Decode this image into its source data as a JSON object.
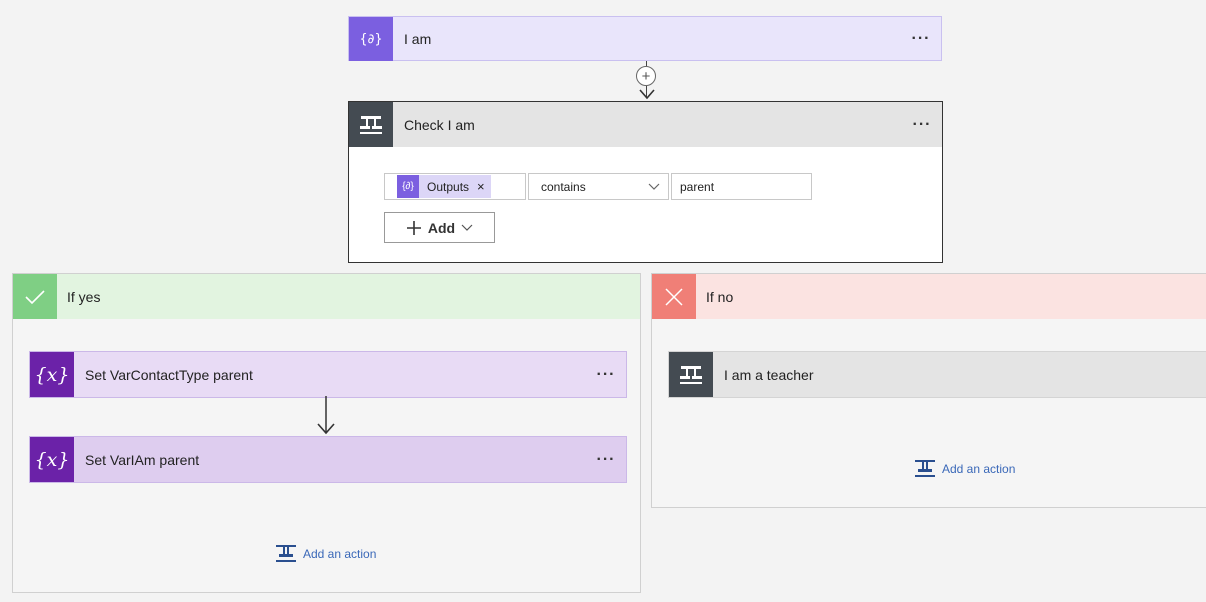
{
  "colors": {
    "variable_accent": "#7b5fe0",
    "set_variable_accent": "#6b22a8",
    "condition_accent": "#444b52",
    "yes_accent": "#7fcf84",
    "no_accent": "#f07f77",
    "link": "#3a68b8"
  },
  "steps": {
    "iam": {
      "title": "I am",
      "icon": "compose-icon",
      "more": "···"
    },
    "check": {
      "title": "Check I am",
      "icon": "condition-icon",
      "more": "···",
      "condition": {
        "left_token": "Outputs",
        "remove": "×",
        "operator": "contains",
        "right_value": "parent"
      },
      "add_label": "Add"
    }
  },
  "branches": {
    "yes": {
      "label": "If yes",
      "actions": [
        {
          "title": "Set VarContactType parent",
          "icon": "variable-icon",
          "more": "···"
        },
        {
          "title": "Set VarIAm parent",
          "icon": "variable-icon",
          "more": "···"
        }
      ],
      "add_action": "Add an action"
    },
    "no": {
      "label": "If no",
      "actions": [
        {
          "title": "I am a teacher",
          "icon": "condition-icon"
        }
      ],
      "add_action": "Add an action"
    }
  },
  "var_glyph": "{x}"
}
